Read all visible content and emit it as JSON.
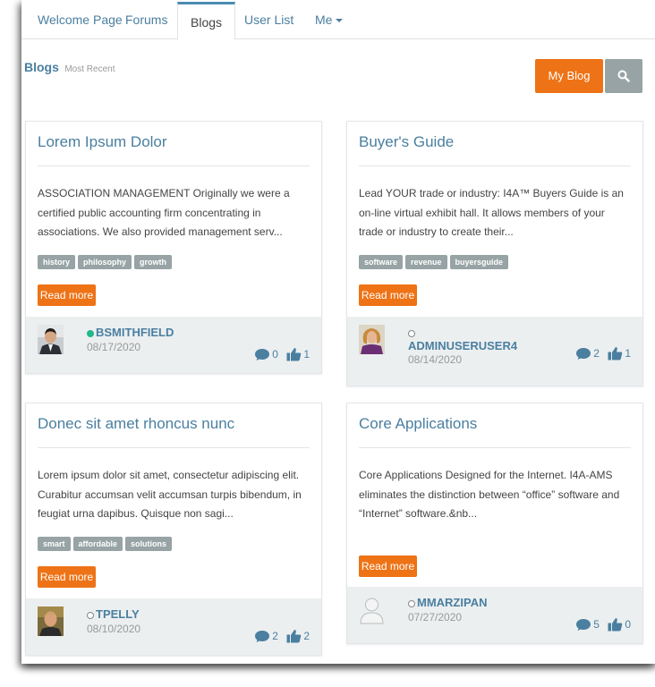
{
  "nav": {
    "tabs": [
      {
        "label": "Welcome Page"
      },
      {
        "label": "Forums"
      },
      {
        "label": "Blogs"
      },
      {
        "label": "User List"
      },
      {
        "label": "Me"
      }
    ]
  },
  "heading": {
    "title": "Blogs",
    "subtitle": "Most Recent"
  },
  "actions": {
    "my_blog": "My Blog",
    "search_icon": "search-icon"
  },
  "colors": {
    "accent": "#ee7316",
    "link": "#4a7fa0",
    "tag": "#97a3a4",
    "online": "#22b88b"
  },
  "posts": [
    {
      "title": "Lorem Ipsum Dolor",
      "excerpt": "ASSOCIATION MANAGEMENT Originally we were a certified public accounting firm concentrating in associations.  We also provided management serv...",
      "tags": [
        "history",
        "philosophy",
        "growth"
      ],
      "read_more": "Read more",
      "author": "BSMITHFIELD",
      "online": true,
      "date": "08/17/2020",
      "comments": "0",
      "likes": "1"
    },
    {
      "title": "Buyer's Guide",
      "excerpt": "Lead YOUR trade or industry: I4A™ Buyers Guide is an on-line virtual exhibit hall.  It allows members of your trade or industry to create their...",
      "tags": [
        "software",
        "revenue",
        "buyersguide"
      ],
      "read_more": "Read more",
      "author": "ADMINUSERUSER4",
      "online": false,
      "date": "08/14/2020",
      "comments": "2",
      "likes": "1"
    },
    {
      "title": "Donec sit amet rhoncus nunc",
      "excerpt": "Lorem ipsum dolor sit amet, consectetur adipiscing elit. Curabitur accumsan velit accumsan turpis bibendum, in feugiat urna dapibus. Quisque non sagi...",
      "tags": [
        "smart",
        "affordable",
        "solutions"
      ],
      "read_more": "Read more",
      "author": "TPELLY",
      "online": false,
      "date": "08/10/2020",
      "comments": "2",
      "likes": "2"
    },
    {
      "title": "Core Applications",
      "excerpt": "Core Applications   Designed for the Internet.  I4A-AMS eliminates the distinction between “office” software and “Internet” software.&nb...",
      "tags": [],
      "read_more": "Read more",
      "author": "MMARZIPAN",
      "online": false,
      "date": "07/27/2020",
      "comments": "5",
      "likes": "0"
    }
  ]
}
